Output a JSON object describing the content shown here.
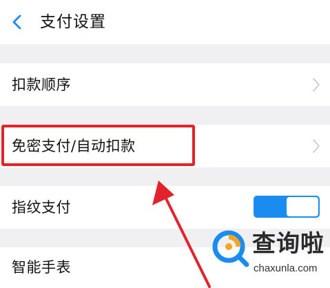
{
  "header": {
    "title": "支付设置",
    "back_icon": "chevron-left-icon"
  },
  "rows": [
    {
      "label": "扣款顺序",
      "icon": "chevron-right-icon"
    },
    {
      "label": "免密支付/自动扣款",
      "icon": "chevron-right-icon"
    },
    {
      "label": "指纹支付",
      "toggle_on": true
    },
    {
      "label": "智能手表"
    }
  ],
  "colors": {
    "accent": "#1a8cf0",
    "highlight": "#e3232c",
    "background": "#f0f0f2"
  },
  "watermark": {
    "text": "查询啦",
    "sub": "chaxunla.com"
  }
}
